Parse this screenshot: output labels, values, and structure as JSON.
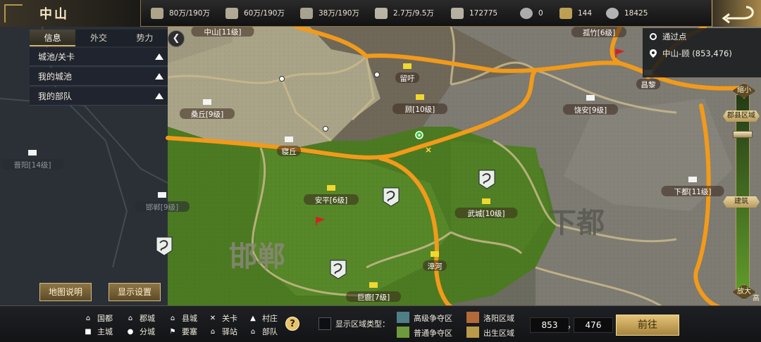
{
  "header": {
    "city_name": "中山",
    "resources": [
      {
        "icon": "wheat-icon",
        "value": "80万/190万"
      },
      {
        "icon": "wood-icon",
        "value": "60万/190万"
      },
      {
        "icon": "stone-icon",
        "value": "38万/190万"
      },
      {
        "icon": "iron-icon",
        "value": "2.7万/9.5万"
      },
      {
        "icon": "feather-icon",
        "value": "172775"
      }
    ],
    "currencies": [
      {
        "icon": "copper-coin-icon",
        "value": "0"
      },
      {
        "icon": "gold-ingot-icon",
        "value": "144"
      },
      {
        "icon": "silver-bowl-icon",
        "value": "18425"
      }
    ]
  },
  "left_panel": {
    "tabs": [
      "信息",
      "外交",
      "势力"
    ],
    "active_tab": "信息",
    "items": [
      "城池/关卡",
      "我的城池",
      "我的部队"
    ],
    "collapse_glyph": "❮"
  },
  "right_info": {
    "waypoint_label": "通过点",
    "location": "中山-顾 (853,476)"
  },
  "zoom": {
    "zoom_out_label": "缩小",
    "zoom_in_label": "放大",
    "level_county": "郡县区域",
    "level_building": "建筑",
    "edge_text": "高"
  },
  "map": {
    "big_labels": [
      "下都",
      "邯郸"
    ],
    "cities": [
      {
        "name": "中山[11级]"
      },
      {
        "name": "孤竹[6级]"
      },
      {
        "name": "留吁"
      },
      {
        "name": "昌黎"
      },
      {
        "name": "顾[10级]"
      },
      {
        "name": "饶安[9级]"
      },
      {
        "name": "桑丘[9级]"
      },
      {
        "name": "寝丘"
      },
      {
        "name": "晋阳[14级]"
      },
      {
        "name": "下都[11级]"
      },
      {
        "name": "邯郸[9级]"
      },
      {
        "name": "安平[6级]"
      },
      {
        "name": "武城[10级]"
      },
      {
        "name": "漳河"
      },
      {
        "name": "巨鹿[7级]"
      }
    ]
  },
  "bottom": {
    "map_help_label": "地图说明",
    "display_settings_label": "显示设置",
    "legend": [
      {
        "icon": "capital-icon",
        "label": "国都"
      },
      {
        "icon": "commandery-icon",
        "label": "郡城"
      },
      {
        "icon": "county-icon",
        "label": "县城"
      },
      {
        "icon": "pass-icon",
        "label": "关卡"
      },
      {
        "icon": "village-icon",
        "label": "村庄"
      },
      {
        "icon": "main-city-icon",
        "label": "主城"
      },
      {
        "icon": "branch-city-icon",
        "label": "分城"
      },
      {
        "icon": "fortress-icon",
        "label": "要塞"
      },
      {
        "icon": "post-station-icon",
        "label": "驿站"
      },
      {
        "icon": "troop-icon",
        "label": "部队"
      }
    ],
    "help_glyph": "?",
    "region_type_label": "显示区域类型：",
    "regions": [
      {
        "label": "高级争夺区",
        "color": "#4f7f86"
      },
      {
        "label": "洛阳区域",
        "color": "#b46a38"
      },
      {
        "label": "普通争夺区",
        "color": "#6d9a3c"
      },
      {
        "label": "出生区域",
        "color": "#b99a49"
      }
    ],
    "coord_x": "853",
    "coord_y": "476",
    "coord_sep": "，",
    "go_label": "前往"
  },
  "colors": {
    "road": "#f29a1a",
    "grass": "#4d7a23",
    "gold": "#d7b56c"
  }
}
